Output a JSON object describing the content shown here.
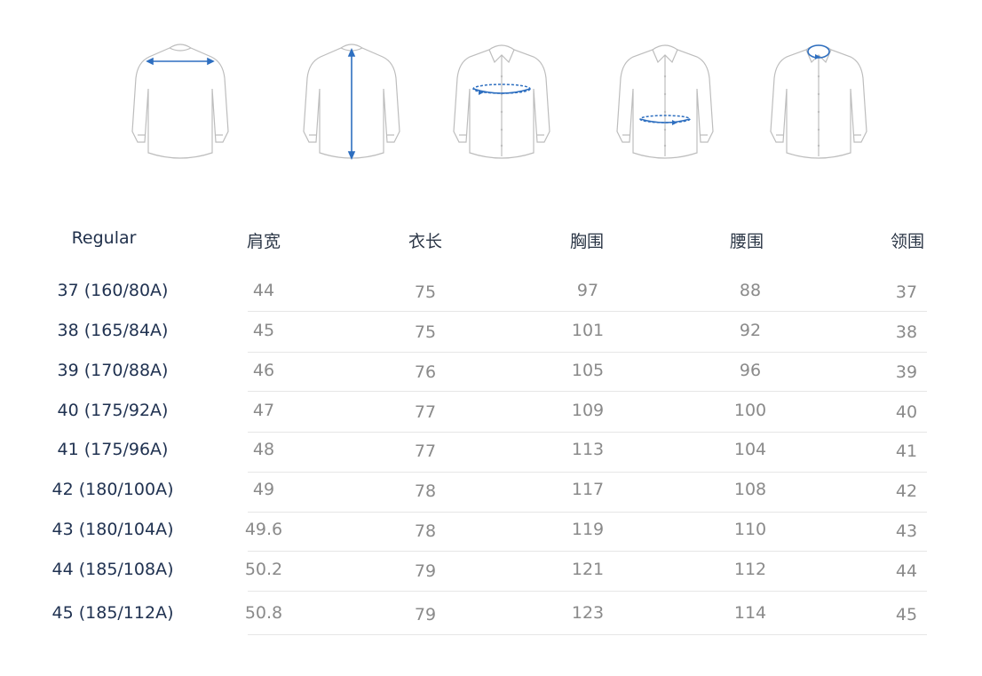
{
  "icons": [
    {
      "name": "shoulder-width-icon"
    },
    {
      "name": "length-icon"
    },
    {
      "name": "chest-icon"
    },
    {
      "name": "waist-icon"
    },
    {
      "name": "collar-icon"
    }
  ],
  "table": {
    "fit_label": "Regular",
    "columns": [
      "肩宽",
      "衣长",
      "胸围",
      "腰围",
      "领围"
    ],
    "rows": [
      {
        "size": "37 (160/80A)",
        "values": [
          "44",
          "75",
          "97",
          "88",
          "37"
        ]
      },
      {
        "size": "38 (165/84A)",
        "values": [
          "45",
          "75",
          "101",
          "92",
          "38"
        ]
      },
      {
        "size": "39 (170/88A)",
        "values": [
          "46",
          "76",
          "105",
          "96",
          "39"
        ]
      },
      {
        "size": "40 (175/92A)",
        "values": [
          "47",
          "77",
          "109",
          "100",
          "40"
        ]
      },
      {
        "size": "41 (175/96A)",
        "values": [
          "48",
          "77",
          "113",
          "104",
          "41"
        ]
      },
      {
        "size": "42 (180/100A)",
        "values": [
          "49",
          "78",
          "117",
          "108",
          "42"
        ]
      },
      {
        "size": "43 (180/104A)",
        "values": [
          "49.6",
          "78",
          "119",
          "110",
          "43"
        ]
      },
      {
        "size": "44 (185/108A)",
        "values": [
          "50.2",
          "79",
          "121",
          "112",
          "44"
        ]
      },
      {
        "size": "45 (185/112A)",
        "values": [
          "50.8",
          "79",
          "123",
          "114",
          "45"
        ]
      }
    ]
  },
  "colors": {
    "accent": "#2e6fc0",
    "outline": "#b9b9b9",
    "text_dark": "#1f3150",
    "text_value": "#8a8a8a"
  }
}
